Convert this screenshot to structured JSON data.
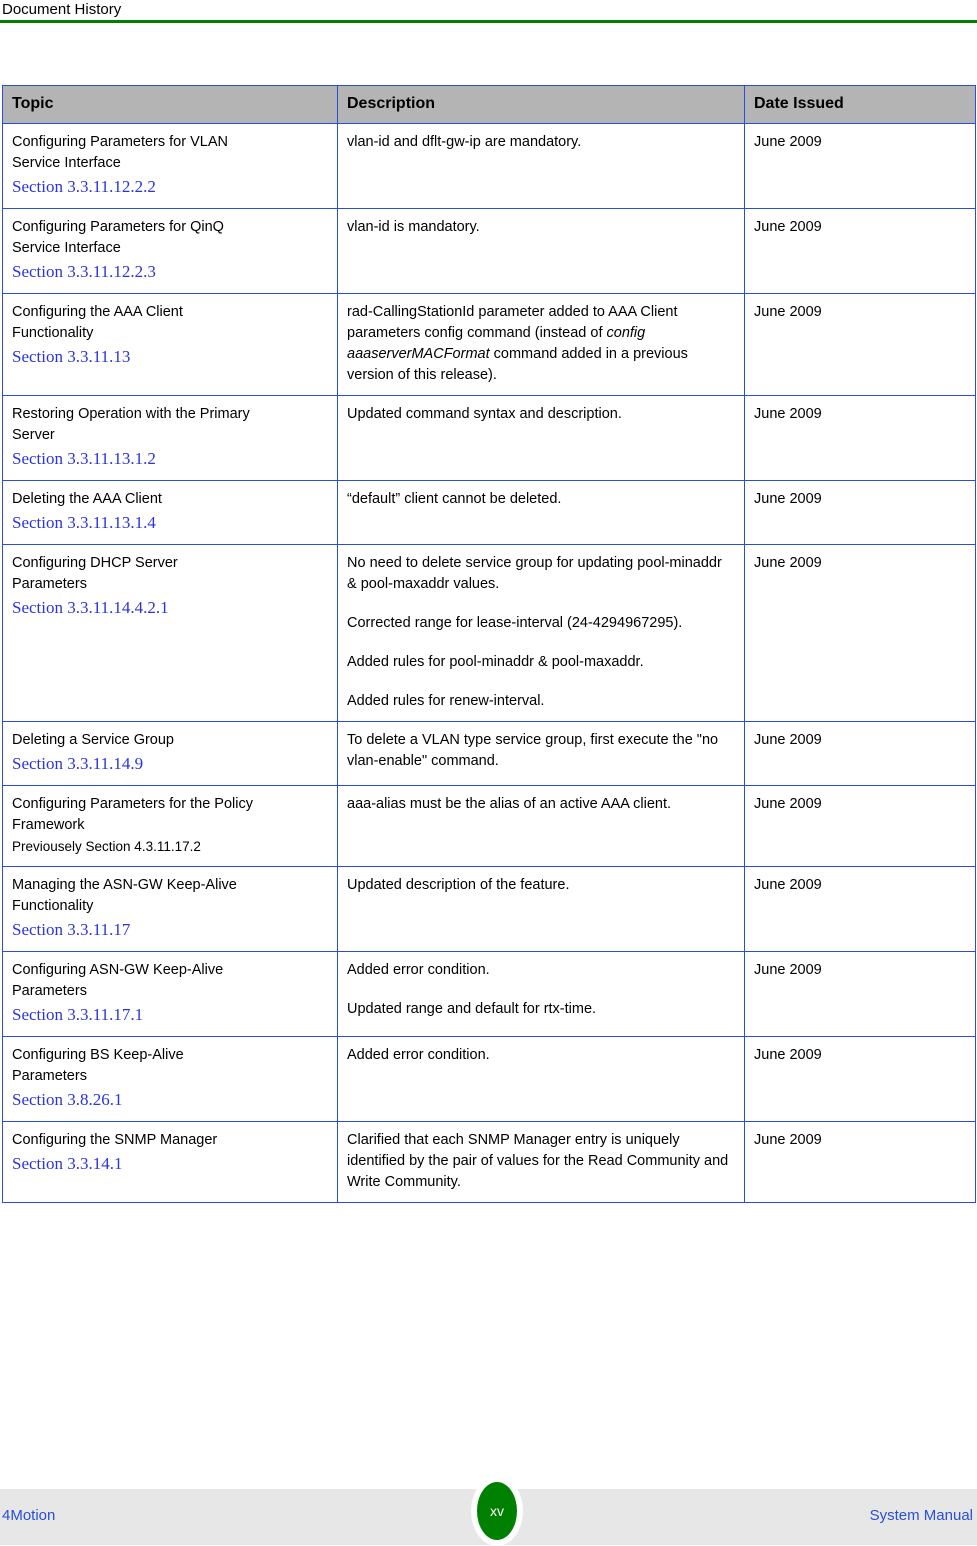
{
  "header": {
    "running_title": "Document History",
    "rule_color": "#008000"
  },
  "table": {
    "columns": [
      "Topic",
      "Description",
      "Date Issued"
    ],
    "header_bg": "#b4b4b4",
    "border_color": "#2a4fd6",
    "link_color": "#2a33e0",
    "rows": [
      {
        "topic_lines": [
          "Configuring Parameters for VLAN",
          "Service Interface"
        ],
        "section": "Section 3.3.11.12.2.2",
        "description": [
          "vlan-id and dflt-gw-ip are mandatory."
        ],
        "date": "June 2009"
      },
      {
        "topic_lines": [
          "Configuring Parameters for QinQ",
          "Service Interface"
        ],
        "section": "Section 3.3.11.12.2.3",
        "description": [
          "vlan-id is mandatory."
        ],
        "date": "June 2009"
      },
      {
        "topic_lines": [
          "Configuring the AAA Client",
          "Functionality"
        ],
        "section": "Section 3.3.11.13",
        "description_html": "rad-CallingStationId parameter added to AAA Client parameters config command (instead of <em>config aaaserverMACFormat</em> command added in a previous version of this release).",
        "date": "June 2009"
      },
      {
        "topic_lines": [
          "Restoring Operation with the Primary",
          "Server"
        ],
        "section": "Section 3.3.11.13.1.2",
        "description": [
          "Updated command syntax and description."
        ],
        "date": "June 2009"
      },
      {
        "topic_lines": [
          "Deleting the AAA Client"
        ],
        "section": "Section 3.3.11.13.1.4",
        "description": [
          "“default” client cannot be deleted."
        ],
        "date": "June 2009"
      },
      {
        "topic_lines": [
          "Configuring DHCP Server",
          "Parameters"
        ],
        "section": "Section 3.3.11.14.4.2.1",
        "description": [
          "No need to delete service group for updating pool-minaddr & pool-maxaddr values.",
          "Corrected range for lease-interval (24-4294967295).",
          "Added rules for pool-minaddr & pool-maxaddr.",
          "Added rules for renew-interval."
        ],
        "date": "June 2009"
      },
      {
        "topic_lines": [
          "Deleting a Service Group"
        ],
        "section": "Section 3.3.11.14.9",
        "description": [
          "To delete a VLAN type service group, first execute the  \"no vlan-enable\" command."
        ],
        "date": "June 2009"
      },
      {
        "topic_lines": [
          "Configuring Parameters for the Policy",
          "Framework"
        ],
        "previous_section": "Previousely Section 4.3.11.17.2",
        "description": [
          "aaa-alias must be the alias of an active AAA client."
        ],
        "date": "June 2009"
      },
      {
        "topic_lines": [
          "Managing the ASN-GW Keep-Alive",
          "Functionality"
        ],
        "section": "Section 3.3.11.17",
        "description": [
          "Updated description of the feature."
        ],
        "date": "June 2009"
      },
      {
        "topic_lines": [
          "Configuring ASN-GW Keep-Alive",
          "Parameters"
        ],
        "section": "Section 3.3.11.17.1",
        "description": [
          "Added error condition.",
          "Updated range and default for rtx-time."
        ],
        "date": "June 2009"
      },
      {
        "topic_lines": [
          "Configuring BS Keep-Alive",
          "Parameters"
        ],
        "section": "Section 3.8.26.1",
        "description": [
          "Added error condition."
        ],
        "date": "June 2009"
      },
      {
        "topic_lines": [
          "Configuring the SNMP Manager"
        ],
        "section": "Section 3.3.14.1",
        "description": [
          "Clarified that each SNMP Manager entry is uniquely identified by the pair of values for the Read Community and Write Community."
        ],
        "date": "June 2009"
      }
    ]
  },
  "footer": {
    "left_label": "4Motion",
    "page_number": "xv",
    "right_label": "System Manual",
    "band_color": "#e7e7e7",
    "badge_color": "#008000",
    "link_color": "#2a4fd6"
  }
}
